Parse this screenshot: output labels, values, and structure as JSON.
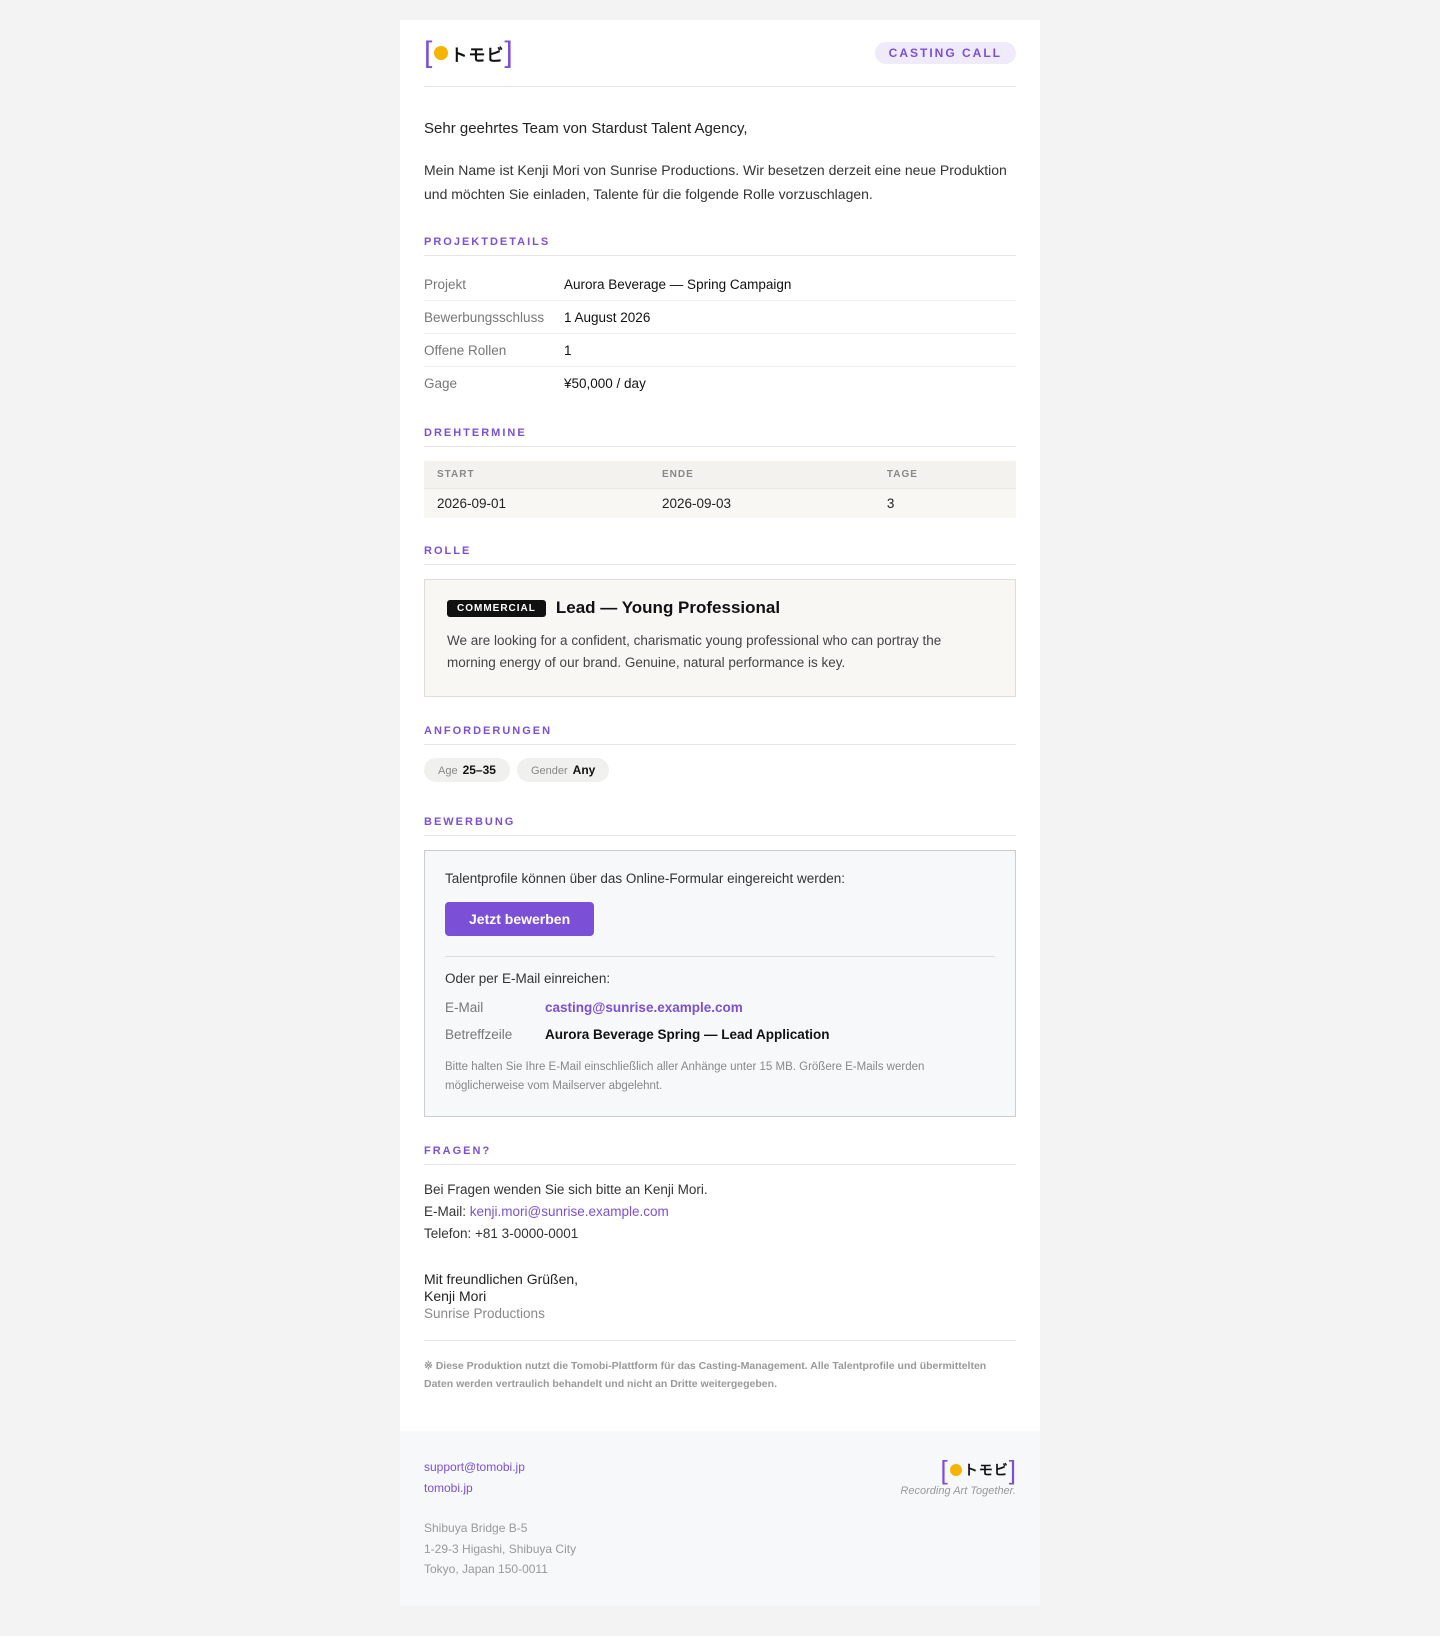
{
  "header": {
    "logo_text": "トモビ",
    "badge": "CASTING CALL"
  },
  "greeting": "Sehr geehrtes Team von Stardust Talent Agency,",
  "intro": "Mein Name ist Kenji Mori von Sunrise Productions. Wir besetzen derzeit eine neue Produktion und möchten Sie einladen, Talente für die folgende Rolle vorzuschlagen.",
  "project": {
    "title": "PROJEKTDETAILS",
    "rows": [
      {
        "label": "Projekt",
        "value": "Aurora Beverage — Spring Campaign"
      },
      {
        "label": "Bewerbungsschluss",
        "value": "1 August 2026"
      },
      {
        "label": "Offene Rollen",
        "value": "1"
      },
      {
        "label": "Gage",
        "value": "¥50,000 / day"
      }
    ]
  },
  "shoot": {
    "title": "DREHTERMINE",
    "headers": [
      "START",
      "ENDE",
      "TAGE"
    ],
    "row": [
      "2026-09-01",
      "2026-09-03",
      "3"
    ]
  },
  "role": {
    "title": "ROLLE",
    "tag": "COMMERCIAL",
    "name": "Lead — Young Professional",
    "description": "We are looking for a confident, charismatic young professional who can portray the morning energy of our brand. Genuine, natural performance is key."
  },
  "requirements": {
    "title": "ANFORDERUNGEN",
    "pills": [
      {
        "key": "Age",
        "value": "25–35"
      },
      {
        "key": "Gender",
        "value": "Any"
      }
    ]
  },
  "application": {
    "title": "BEWERBUNG",
    "text": "Talentprofile können über das Online-Formular eingereicht werden:",
    "button": "Jetzt bewerben",
    "or_text": "Oder per E-Mail einreichen:",
    "email_label": "E-Mail",
    "email_value": "casting@sunrise.example.com",
    "subject_label": "Betreffzeile",
    "subject_value": "Aurora Beverage Spring — Lead Application",
    "note": "Bitte halten Sie Ihre E-Mail einschließlich aller Anhänge unter 15 MB. Größere E-Mails werden möglicherweise vom Mailserver abgelehnt."
  },
  "questions": {
    "title": "FRAGEN?",
    "line1": "Bei Fragen wenden Sie sich bitte an Kenji Mori.",
    "email_prefix": "E-Mail: ",
    "email": "kenji.mori@sunrise.example.com",
    "phone": "Telefon: +81 3-0000-0001"
  },
  "signoff": {
    "closing": "Mit freundlichen Grüßen,",
    "name": "Kenji Mori",
    "company": "Sunrise Productions"
  },
  "disclaimer": "※ Diese Produktion nutzt die Tomobi-Plattform für das Casting-Management. Alle Talentprofile und übermittelten Daten werden vertraulich behandelt und nicht an Dritte weitergegeben.",
  "footer": {
    "support_email": "support@tomobi.jp",
    "site": "tomobi.jp",
    "address": [
      "Shibuya Bridge B-5",
      "1-29-3 Higashi, Shibuya City",
      "Tokyo, Japan 150-0011"
    ],
    "tagline": "Recording Art Together."
  },
  "colors": {
    "accent": "#7b4fd6",
    "logo_dot": "#f6b400"
  }
}
